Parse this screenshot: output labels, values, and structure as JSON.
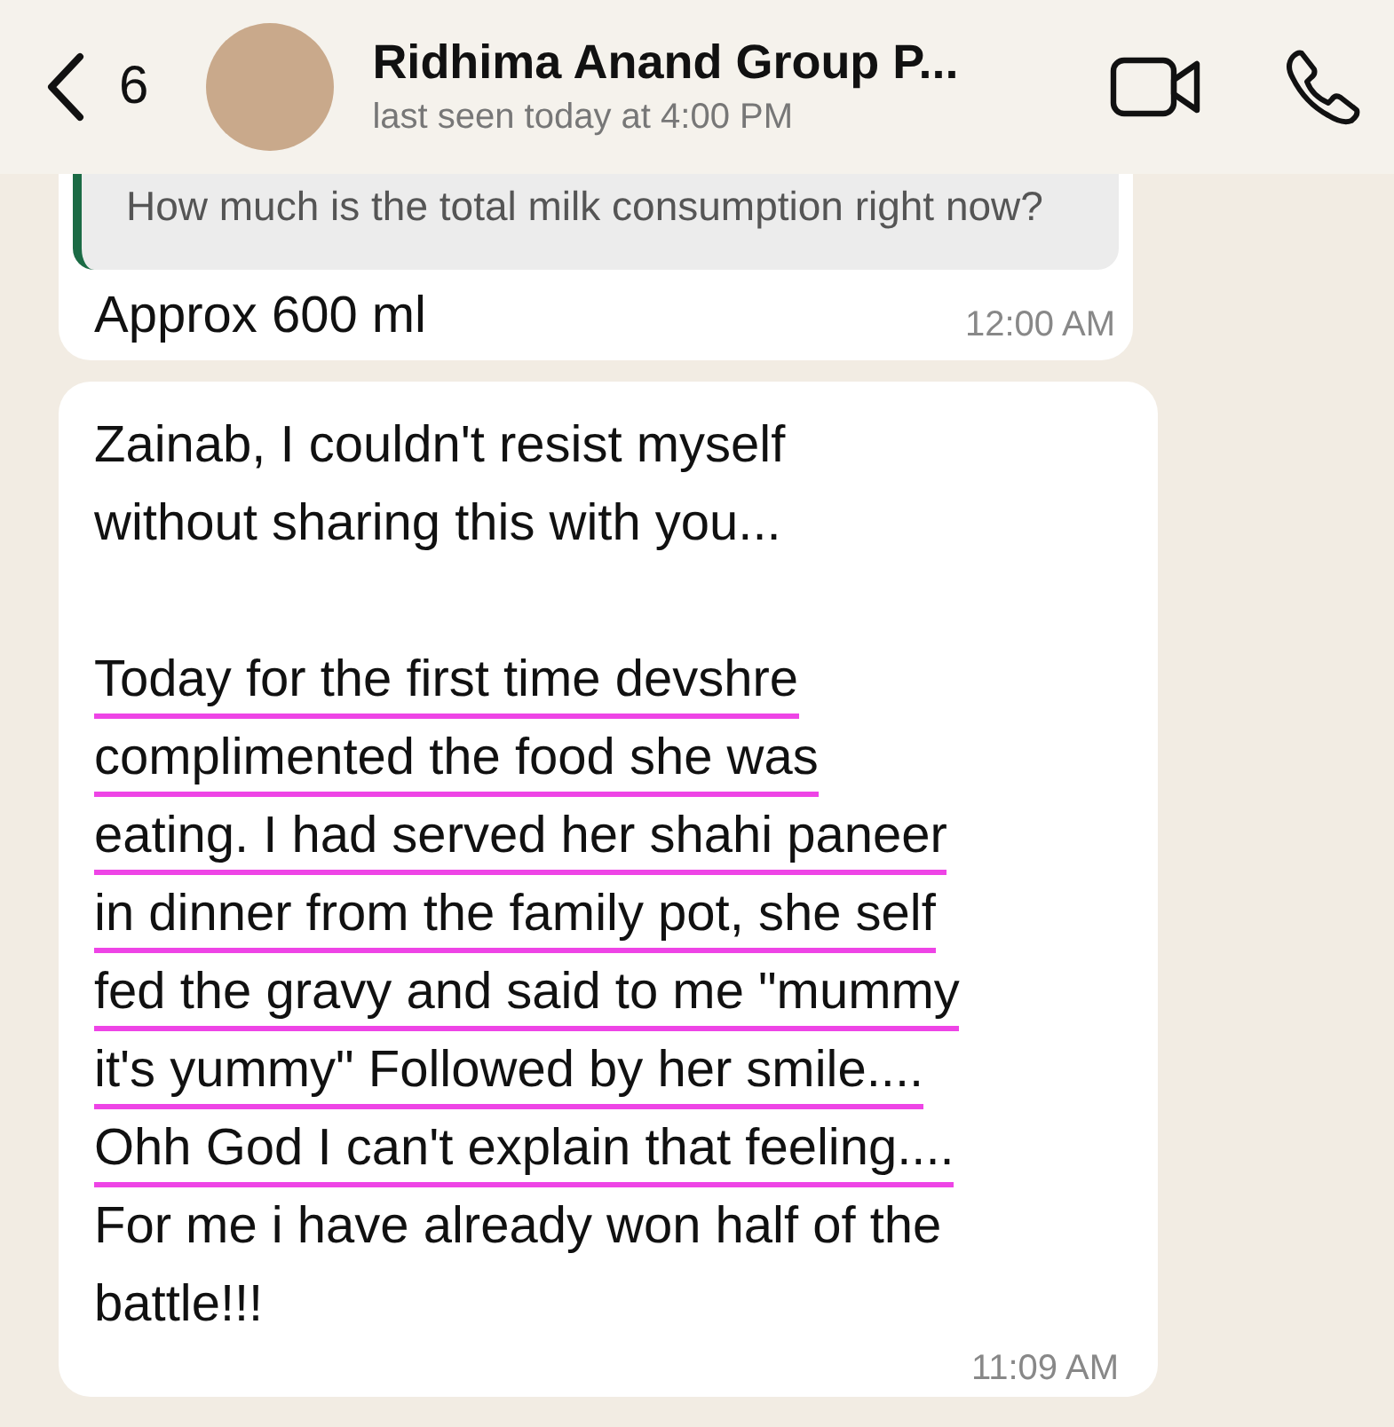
{
  "header": {
    "back_count": "6",
    "title": "Ridhima Anand Group P...",
    "subtitle": "last seen today at 4:00 PM"
  },
  "messages": [
    {
      "kind": "reply",
      "quote": "How much is the total milk consumption right now?",
      "text": "Approx 600 ml",
      "time": "12:00 AM"
    },
    {
      "kind": "text",
      "paragraphs": [
        [
          {
            "text": "Zainab, I couldn't resist myself",
            "underlined": false
          },
          {
            "text": "without sharing this with you...",
            "underlined": false
          }
        ],
        [
          {
            "text": "Today for the first time devshre",
            "underlined": true
          },
          {
            "text": "complimented the food she was",
            "underlined": true
          },
          {
            "text": "eating. I had served her shahi paneer",
            "underlined": true
          },
          {
            "text": "in dinner from the family pot, she self",
            "underlined": true
          },
          {
            "text": "fed the gravy and said to me \"mummy",
            "underlined": true
          },
          {
            "text": "it's yummy\" Followed by her smile....",
            "underlined": true
          },
          {
            "text": "Ohh God I can't explain that feeling....",
            "underlined": true
          },
          {
            "text": "For me i have already won half of the",
            "underlined": false
          },
          {
            "text": "battle!!!",
            "underlined": false
          }
        ]
      ],
      "time": "11:09 AM"
    }
  ]
}
